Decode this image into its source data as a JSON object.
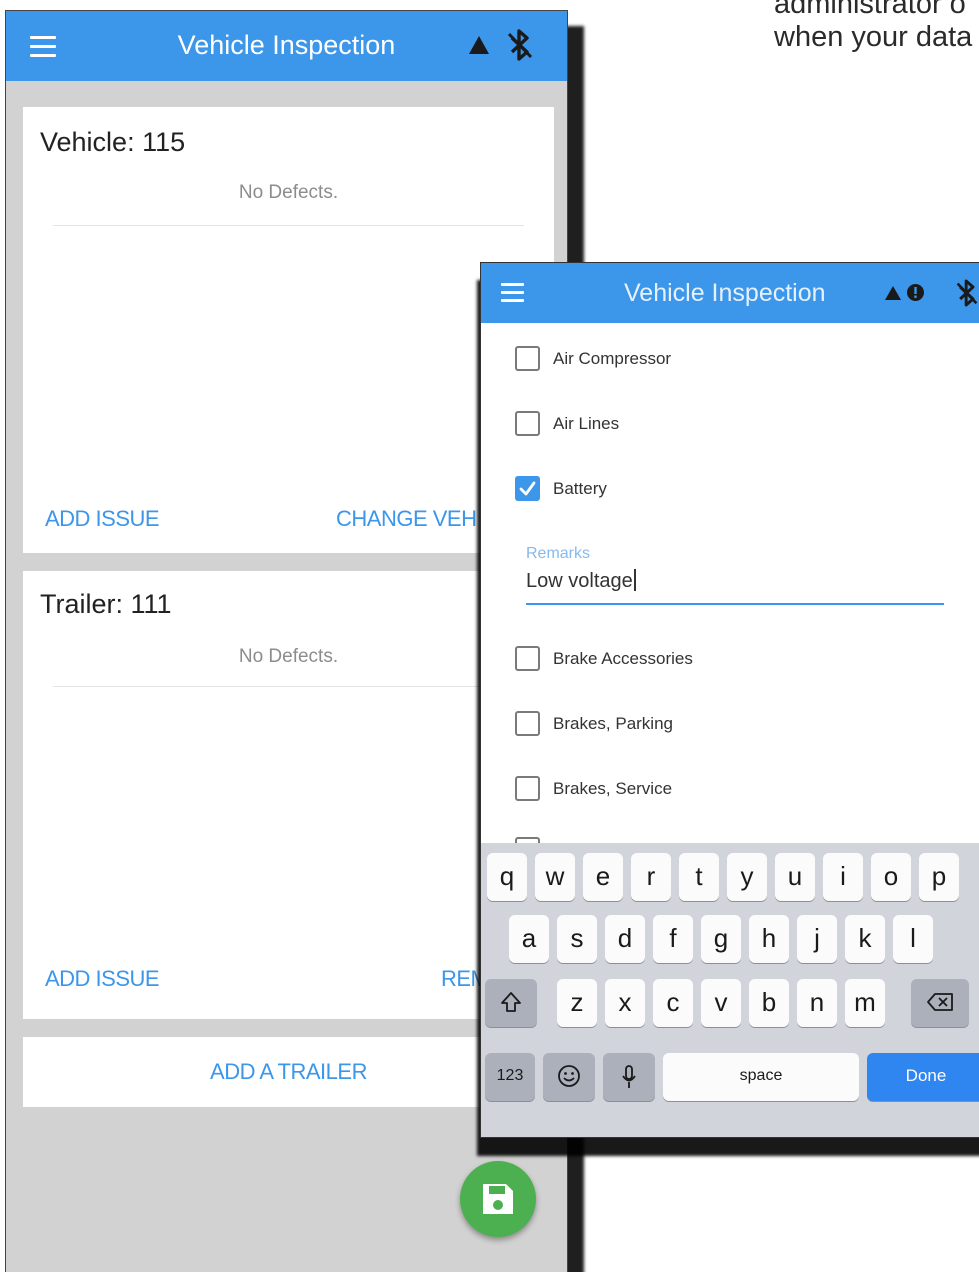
{
  "caption": {
    "line1": "administrator o",
    "line2": "when your data"
  },
  "back_phone": {
    "title": "Vehicle Inspection",
    "vehicle_card": {
      "title": "Vehicle: 115",
      "status": "No Defects.",
      "add_issue": "ADD ISSUE",
      "change": "CHANGE VEH"
    },
    "trailer_card": {
      "title": "Trailer: 111",
      "status": "No Defects.",
      "add_issue": "ADD ISSUE",
      "remove": "REM"
    },
    "add_trailer": "ADD A TRAILER",
    "icons": [
      "menu-icon",
      "warning-icon",
      "bluetooth-off-icon",
      "save-icon"
    ]
  },
  "front_phone": {
    "title": "Vehicle Inspection",
    "items": [
      {
        "label": "Air Compressor",
        "checked": false
      },
      {
        "label": "Air Lines",
        "checked": false
      },
      {
        "label": "Battery",
        "checked": true
      },
      {
        "label": "Brake Accessories",
        "checked": false
      },
      {
        "label": "Brakes, Parking",
        "checked": false
      },
      {
        "label": "Brakes, Service",
        "checked": false
      }
    ],
    "remarks": {
      "label": "Remarks",
      "value": "Low voltage"
    },
    "icons": [
      "menu-icon",
      "warning-icon",
      "info-icon",
      "bluetooth-off-icon"
    ],
    "keyboard": {
      "row1": [
        "q",
        "w",
        "e",
        "r",
        "t",
        "y",
        "u",
        "i",
        "o",
        "p"
      ],
      "row2": [
        "a",
        "s",
        "d",
        "f",
        "g",
        "h",
        "j",
        "k",
        "l"
      ],
      "row3": [
        "z",
        "x",
        "c",
        "v",
        "b",
        "n",
        "m"
      ],
      "numbers": "123",
      "space": "space",
      "done": "Done"
    }
  },
  "colors": {
    "primary": "#3c96ea",
    "fab": "#4caf50",
    "background": "#d2d2d2"
  }
}
